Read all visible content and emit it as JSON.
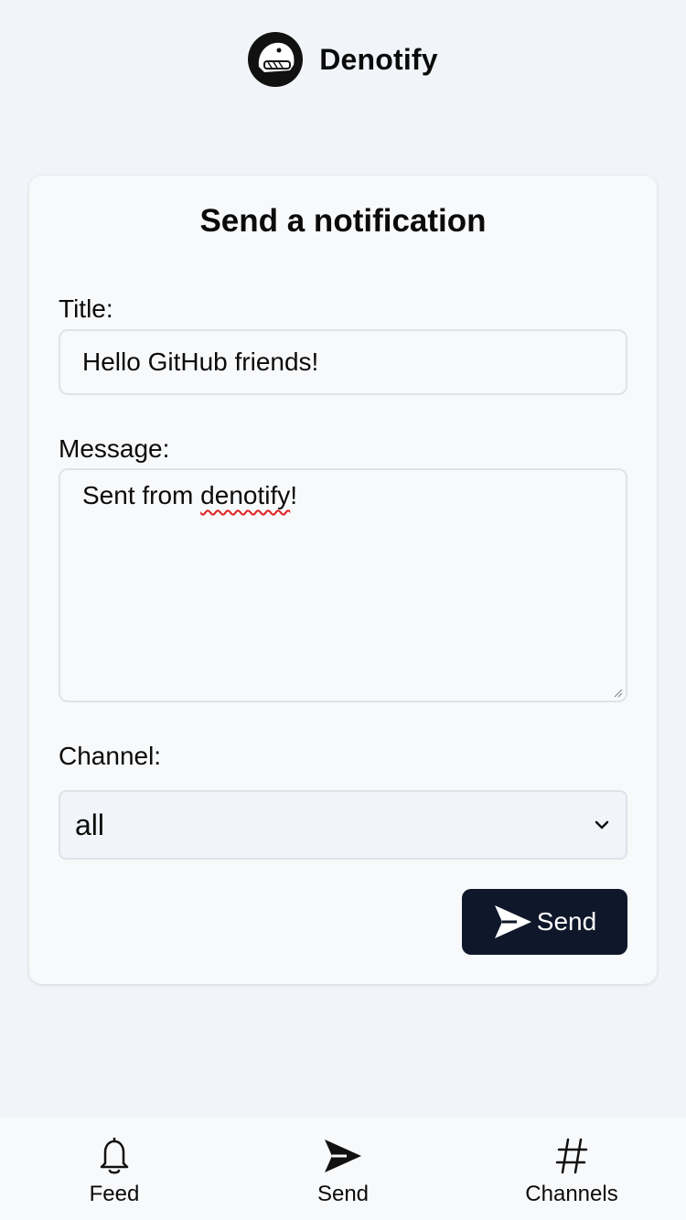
{
  "header": {
    "app_name": "Denotify",
    "logo_icon": "dino-logo-icon"
  },
  "form": {
    "heading": "Send a notification",
    "title_label": "Title:",
    "title_value": "Hello GitHub friends!",
    "message_label": "Message:",
    "message_prefix": "Sent from ",
    "message_misspelled": "denotify",
    "message_suffix": "!",
    "channel_label": "Channel:",
    "channel_selected": "all",
    "send_label": "Send"
  },
  "nav": {
    "items": [
      {
        "label": "Feed",
        "icon": "bell-icon"
      },
      {
        "label": "Send",
        "icon": "paper-plane-icon"
      },
      {
        "label": "Channels",
        "icon": "hash-icon"
      }
    ]
  },
  "colors": {
    "background": "#f1f4f8",
    "card": "#f8f9fb",
    "primary_button": "#0f172a",
    "spellcheck": "#e02020"
  }
}
